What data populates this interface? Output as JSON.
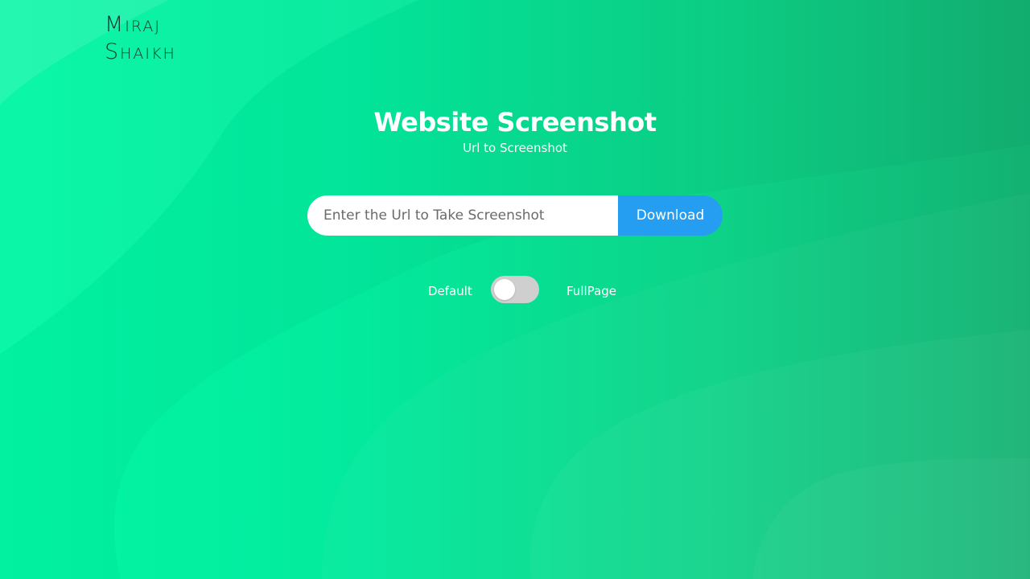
{
  "brand": {
    "line1": "Miraj",
    "line2": "Shaikh"
  },
  "hero": {
    "title": "Website Screenshot",
    "subtitle": "Url to Screenshot"
  },
  "search": {
    "value": "",
    "placeholder": "Enter the Url to Take Screenshot",
    "button_label": "Download"
  },
  "mode": {
    "left_label": "Default",
    "right_label": "FullPage",
    "full_page_enabled": false
  },
  "colors": {
    "background_start": "#02f7a4",
    "background_end": "#13b172",
    "button": "#259ef2",
    "toggle_track": "#cfcfcf",
    "logo_text": "#0b3b33"
  }
}
